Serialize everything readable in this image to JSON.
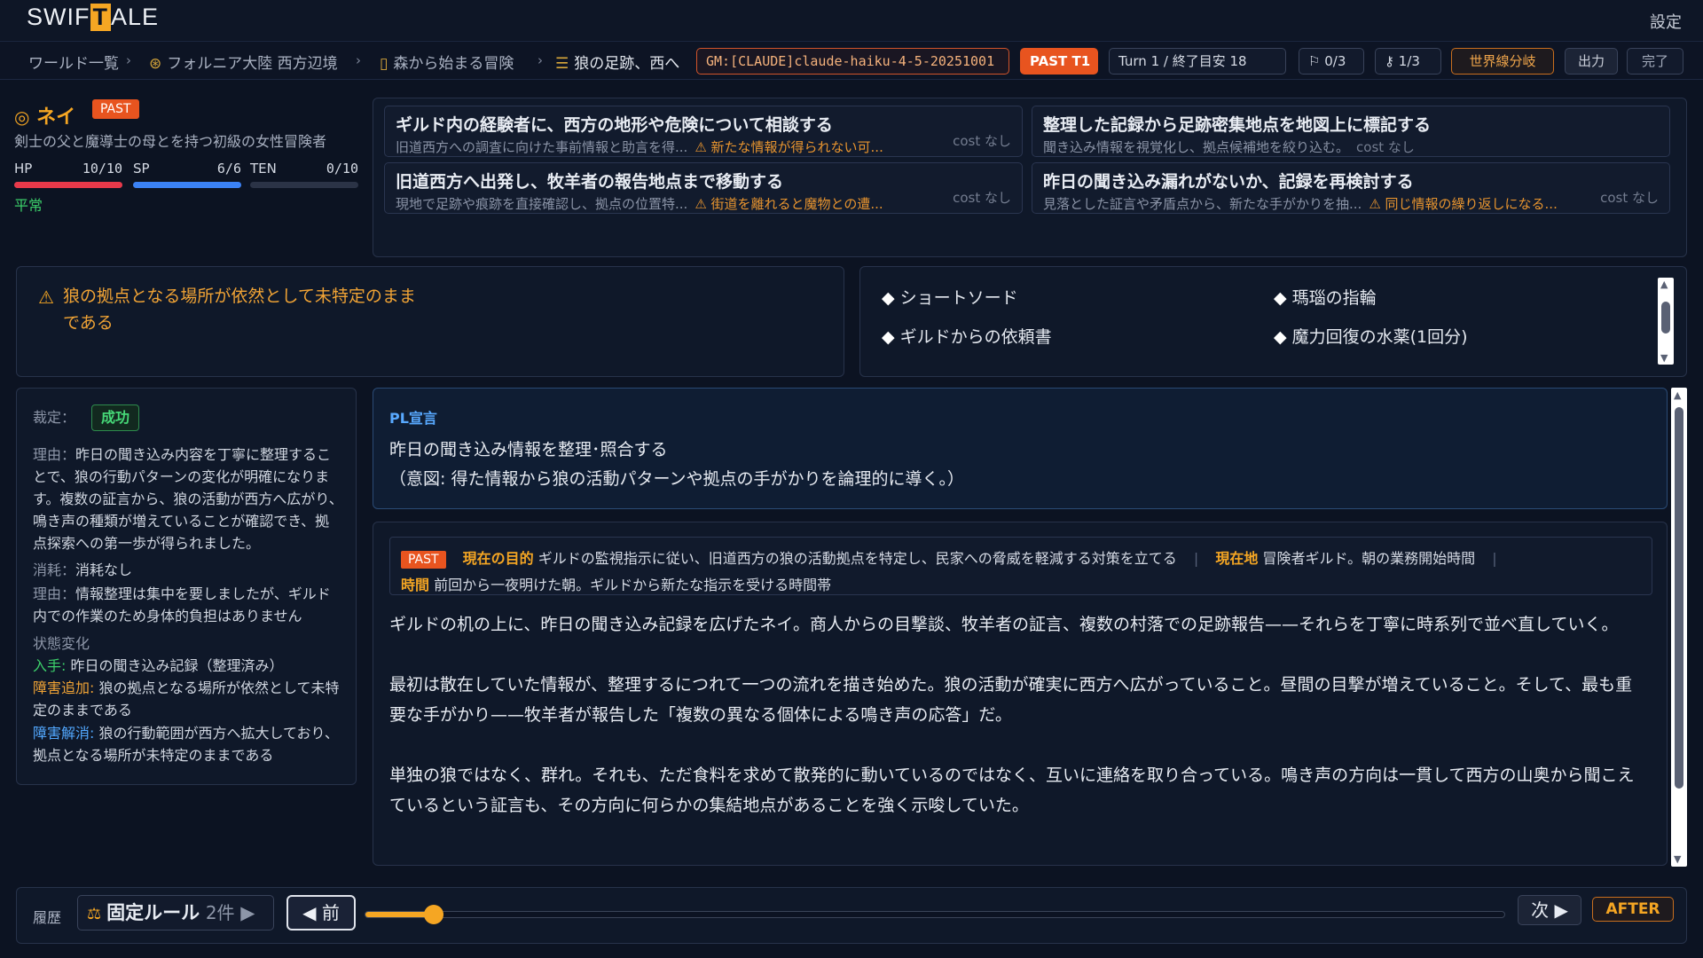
{
  "app": {
    "logo_pre": "SWIF",
    "logo_t": "T",
    "logo_post": "ALE",
    "settings": "設定"
  },
  "breadcrumb": {
    "world_list": "ワールド一覧",
    "region": "フォルニア大陸 西方辺境",
    "story": "森から始まる冒険",
    "chapter": "狼の足跡、西へ",
    "sep": "›"
  },
  "header_pills": {
    "gm": "GM:[CLAUDE]claude-haiku-4-5-20251001",
    "past": "PAST T1",
    "turn": "Turn 1 / 終了目安 18",
    "flags": "0/3",
    "keys": "1/3",
    "world_branch": "世界線分岐",
    "export": "出力",
    "done": "完了"
  },
  "character": {
    "name": "ネイ",
    "badge": "PAST",
    "description": "剣士の父と魔導士の母とを持つ初級の女性冒険者",
    "stats": [
      {
        "label": "HP",
        "value": "10/10",
        "fraction": 1.0,
        "color": "#e8394a"
      },
      {
        "label": "SP",
        "value": "6/6",
        "fraction": 1.0,
        "color": "#3b82f6"
      },
      {
        "label": "TEN",
        "value": "0/10",
        "fraction": 0.0,
        "color": "#6b7280"
      }
    ],
    "status": "平常"
  },
  "actions": [
    {
      "title": "ギルド内の経験者に、西方の地形や危険について相談する",
      "desc": "旧道西方への調査に向けた事前情報と助言を得...",
      "risk": "⚠ 新たな情報が得られない可...",
      "cost": "cost なし"
    },
    {
      "title": "整理した記録から足跡密集地点を地図上に標記する",
      "desc": "聞き込み情報を視覚化し、拠点候補地を絞り込む。",
      "risk": "",
      "cost": "cost なし"
    },
    {
      "title": "旧道西方へ出発し、牧羊者の報告地点まで移動する",
      "desc": "現地で足跡や痕跡を直接確認し、拠点の位置特...",
      "risk": "⚠ 街道を離れると魔物との遭...",
      "cost": "cost なし"
    },
    {
      "title": "昨日の聞き込み漏れがないか、記録を再検討する",
      "desc": "見落とした証言や矛盾点から、新たな手がかりを抽...",
      "risk": "⚠ 同じ情報の繰り返しになる...",
      "cost": "cost なし"
    }
  ],
  "obstacle": {
    "icon": "⚠",
    "text_line1": "狼の拠点となる場所が依然として未特定のまま",
    "text_line2": "である"
  },
  "inventory": [
    "ショートソード",
    "瑪瑙の指輪",
    "ギルドからの依頼書",
    "魔力回復の水薬(1回分)"
  ],
  "judgment": {
    "verdict_label": "裁定：",
    "verdict": "成功",
    "reason_label": "理由：",
    "reason": "昨日の聞き込み内容を丁寧に整理することで、狼の行動パターンの変化が明確になります。複数の証言から、狼の活動が西方へ広がり、鳴き声の種類が増えていることが確認でき、拠点探索への第一歩が得られました。",
    "cost_label": "消耗：",
    "cost": "消耗なし",
    "cost_reason_label": "理由：",
    "cost_reason": "情報整理は集中を要しましたが、ギルド内での作業のため身体的負担はありません",
    "changes_label": "状態変化",
    "acquired_label": "入手:",
    "acquired": "昨日の聞き込み記録（整理済み）",
    "obstacle_add_label": "障害追加:",
    "obstacle_add": "狼の拠点となる場所が依然として未特定のままである",
    "obstacle_clear_label": "障害解消:",
    "obstacle_clear": "狼の行動範囲が西方へ拡大しており、拠点となる場所が未特定のままである"
  },
  "declaration": {
    "header": "PL宣言",
    "line1": "昨日の聞き込み情報を整理･照合する",
    "line2": "（意図: 得た情報から狼の活動パターンや拠点の手がかりを論理的に導く。）"
  },
  "context": {
    "badge": "PAST",
    "goal_label": "現在の目的",
    "goal": "ギルドの監視指示に従い、旧道西方の狼の活動拠点を特定し、民家への脅威を軽減する対策を立てる",
    "location_label": "現在地",
    "location": "冒険者ギルド。朝の業務開始時間",
    "time_label": "時間",
    "time": "前回から一夜明けた朝。ギルドから新たな指示を受ける時間帯"
  },
  "narrative": [
    "ギルドの机の上に、昨日の聞き込み記録を広げたネイ。商人からの目撃談、牧羊者の証言、複数の村落での足跡報告——それらを丁寧に時系列で並べ直していく。",
    "最初は散在していた情報が、整理するにつれて一つの流れを描き始めた。狼の活動が確実に西方へ広がっていること。昼間の目撃が増えていること。そして、最も重要な手がかり——牧羊者が報告した「複数の異なる個体による鳴き声の応答」だ。",
    "単独の狼ではなく、群れ。それも、ただ食料を求めて散発的に動いているのではなく、互いに連絡を取り合っている。鳴き声の方向は一貫して西方の山奥から聞こえているという証言も、その方向に何らかの集結地点があることを強く示唆していた。"
  ],
  "timeline": {
    "history_label": "履歴",
    "rules_label": "固定ルール",
    "rules_count": "2件",
    "prev": "◀ 前",
    "next": "次 ▶",
    "after": "AFTER",
    "progress": 0.06
  }
}
